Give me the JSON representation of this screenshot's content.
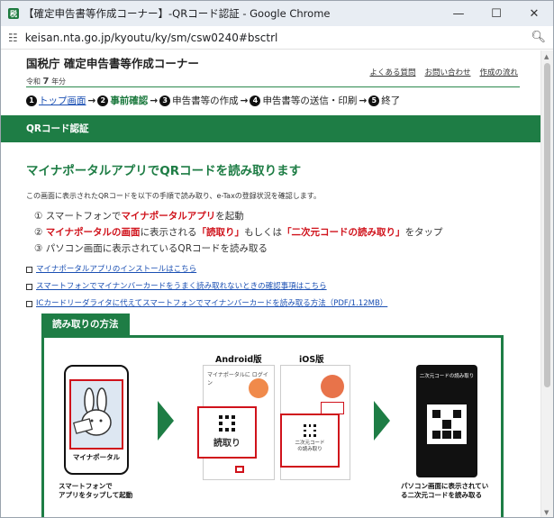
{
  "window": {
    "title": "【確定申告書等作成コーナー】-QRコード認証 - Google Chrome",
    "url": "keisan.nta.go.jp/kyoutu/ky/sm/csw0240#bsctrl"
  },
  "header": {
    "site_title": "国税庁 確定申告書等作成コーナー",
    "era_prefix": "令和",
    "era_year": "7",
    "era_suffix": "年分",
    "links": [
      "よくある質問",
      "お問い合わせ",
      "作成の流れ"
    ]
  },
  "steps": [
    {
      "num": "1",
      "label": "トップ画面"
    },
    {
      "num": "2",
      "label": "事前確認"
    },
    {
      "num": "3",
      "label": "申告書等の作成"
    },
    {
      "num": "4",
      "label": "申告書等の送信・印刷"
    },
    {
      "num": "5",
      "label": "終了"
    }
  ],
  "section_title": "QRコード認証",
  "main_heading": "マイナポータルアプリでQRコードを読み取ります",
  "intro": "この画面に表示されたQRコードを以下の手順で読み取り、e-Taxの登録状況を確認します。",
  "instructions": {
    "i1_pre": "① スマートフォンで",
    "i1_red": "マイナポータルアプリ",
    "i1_post": "を起動",
    "i2_pre": "② ",
    "i2_red": "マイナポータルの画面",
    "i2_mid": "に表示される",
    "i2_red2": "「読取り」",
    "i2_mid2": "もしくは",
    "i2_red3": "「二次元コードの読み取り」",
    "i2_post": "をタップ",
    "i3": "③ パソコン画面に表示されているQRコードを読み取る"
  },
  "links": [
    "マイナポータルアプリのインストールはこちら",
    "スマートフォンでマイナンバーカードをうまく読み取れないときの確認事項はこちら",
    "ICカードリーダライタに代えてスマートフォンでマイナンバーカードを読み取る方法（PDF/1.12MB）"
  ],
  "method": {
    "tab": "読み取りの方法",
    "phone_label": "マイナポータル",
    "caption1_line1": "スマートフォンで",
    "caption1_line2": "アプリをタップして起動",
    "android": "Android版",
    "ios": "iOS版",
    "android_screen_text": "マイナポータルに ログイン",
    "read_label": "読取り",
    "ios_read_label": "二次元コードの読み取り",
    "qr_screen_title": "二次元コードの読み取り",
    "caption3_line1": "パソコン画面に表示されてい",
    "caption3_line2": "る二次元コードを読み取る"
  }
}
